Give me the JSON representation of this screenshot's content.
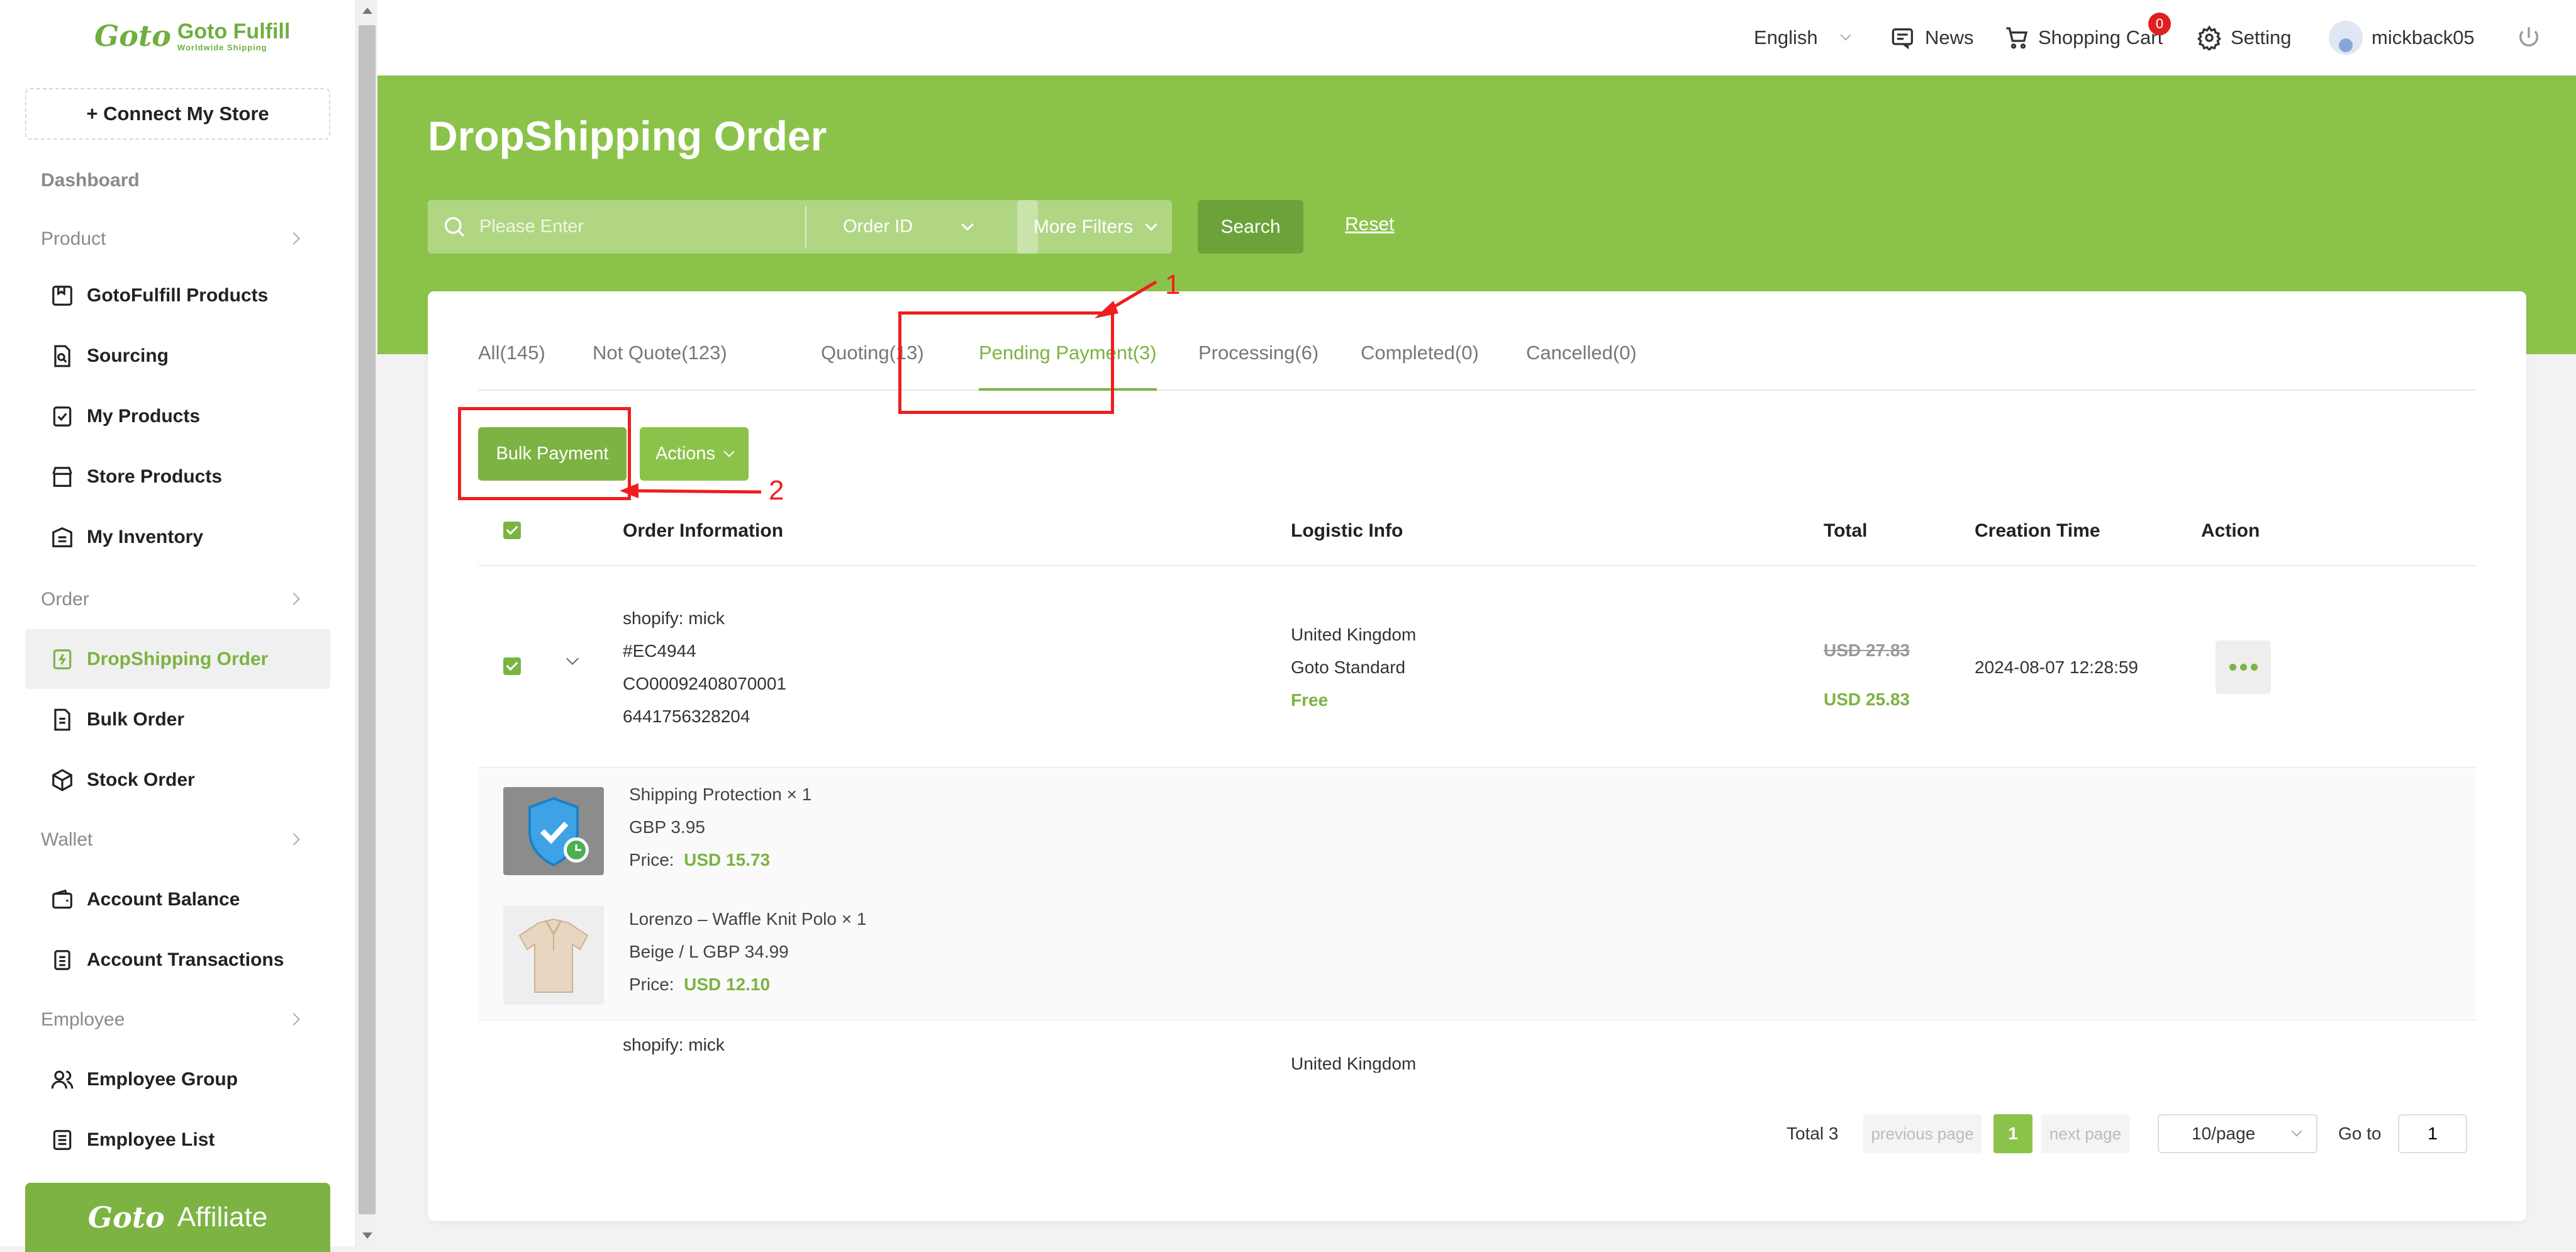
{
  "sidebar": {
    "logo_mark": "Goto",
    "logo_brand": "Goto Fulfill",
    "logo_tagline": "Worldwide Shipping",
    "connect_label": "+ Connect My Store",
    "dashboard": "Dashboard",
    "sections": {
      "product": "Product",
      "order": "Order",
      "wallet": "Wallet",
      "employee": "Employee"
    },
    "items": {
      "gotofulfill_products": "GotoFulfill Products",
      "sourcing": "Sourcing",
      "my_products": "My Products",
      "store_products": "Store Products",
      "my_inventory": "My Inventory",
      "dropshipping_order": "DropShipping Order",
      "bulk_order": "Bulk Order",
      "stock_order": "Stock Order",
      "account_balance": "Account Balance",
      "account_transactions": "Account Transactions",
      "employee_group": "Employee Group",
      "employee_list": "Employee List"
    },
    "affiliate_label": "Affiliate"
  },
  "topbar": {
    "language": "English",
    "news": "News",
    "cart": "Shopping Cart",
    "cart_count": "0",
    "setting": "Setting",
    "username": "mickback05"
  },
  "header": {
    "title": "DropShipping Order",
    "search_placeholder": "Please Enter",
    "field_select": "Order ID",
    "more_filters": "More Filters",
    "search_button": "Search",
    "reset": "Reset"
  },
  "tabs": [
    {
      "label": "All(145)"
    },
    {
      "label": "Not Quote(123)"
    },
    {
      "label": "Quoting(13)"
    },
    {
      "label": "Pending Payment(3)"
    },
    {
      "label": "Processing(6)"
    },
    {
      "label": "Completed(0)"
    },
    {
      "label": "Cancelled(0)"
    }
  ],
  "active_tab": "Pending Payment(3)",
  "toolbar": {
    "bulk_payment": "Bulk Payment",
    "actions": "Actions"
  },
  "table": {
    "headers": [
      "Order Information",
      "Logistic Info",
      "Total",
      "Creation Time",
      "Action"
    ],
    "rows": [
      {
        "store": "shopify: mick",
        "order_no": "#EC4944",
        "co_id": "CO00092408070001",
        "ext_id": "6441756328204",
        "country": "United Kingdom",
        "shipping_method": "Goto Standard",
        "shipping_fee": "Free",
        "original_total": "USD 27.83",
        "total": "USD 25.83",
        "created": "2024-08-07 12:28:59",
        "items": [
          {
            "name": "Shipping Protection × 1",
            "variant": "GBP 3.95",
            "price_label": "Price:",
            "price": "USD 15.73"
          },
          {
            "name": "Lorenzo – Waffle Knit Polo × 1",
            "variant": "Beige / L GBP 34.99",
            "price_label": "Price:",
            "price": "USD 12.10"
          }
        ]
      },
      {
        "store": "shopify: mick",
        "country": "United Kingdom"
      }
    ]
  },
  "pagination": {
    "total": "Total 3",
    "previous": "previous page",
    "current": "1",
    "next": "next page",
    "page_size": "10/page",
    "goto_label": "Go to",
    "goto_value": "1"
  },
  "annotations": {
    "one": "1",
    "two": "2"
  },
  "colors": {
    "brand_green": "#8bc34a",
    "accent_green": "#7cb342",
    "annotation_red": "#f01e1e"
  }
}
